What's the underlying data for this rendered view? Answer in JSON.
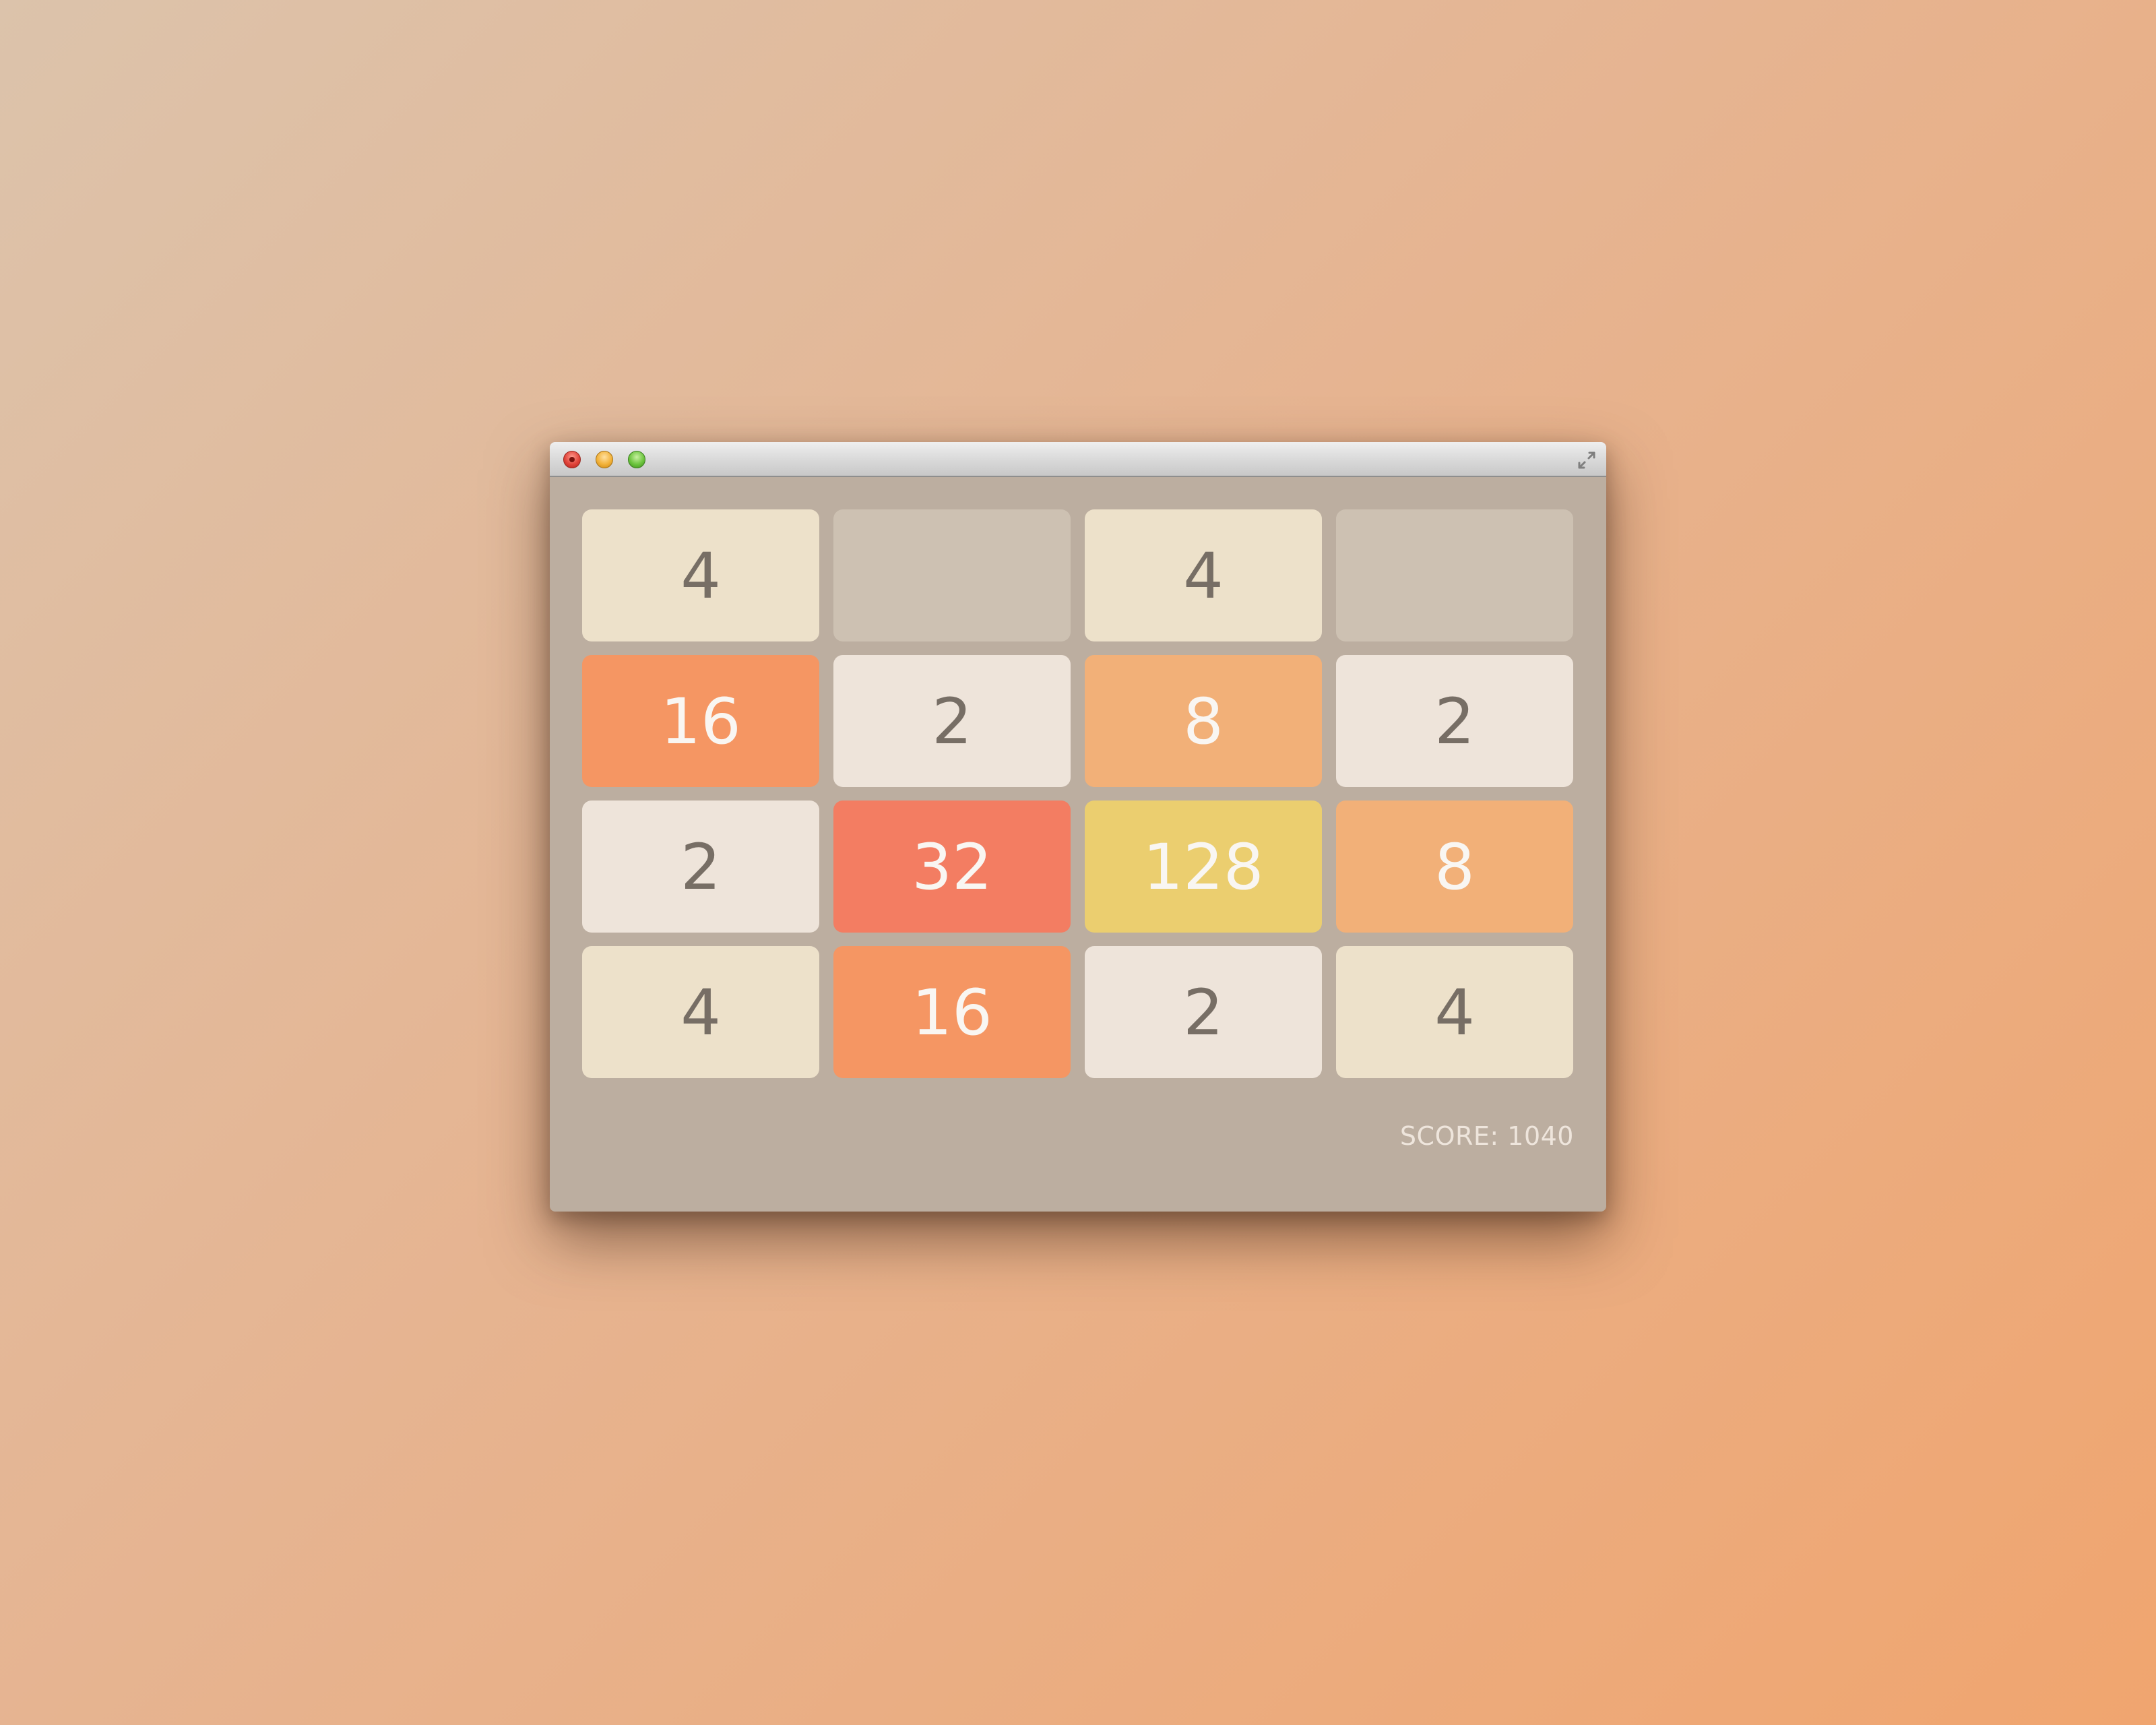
{
  "window": {
    "controls": [
      "close",
      "minimize",
      "zoom",
      "fullscreen"
    ]
  },
  "board": {
    "tiles": [
      {
        "value": "4",
        "bg": "#ede1ca",
        "fg": "#776e65"
      },
      {
        "value": "",
        "bg": "#cdc1b2",
        "fg": "#776e65"
      },
      {
        "value": "4",
        "bg": "#ede1ca",
        "fg": "#776e65"
      },
      {
        "value": "",
        "bg": "#cdc1b2",
        "fg": "#776e65"
      },
      {
        "value": "16",
        "bg": "#f59663",
        "fg": "#f9f6f2"
      },
      {
        "value": "2",
        "bg": "#eee4da",
        "fg": "#776e65"
      },
      {
        "value": "8",
        "bg": "#f2b078",
        "fg": "#f9f6f2"
      },
      {
        "value": "2",
        "bg": "#eee4da",
        "fg": "#776e65"
      },
      {
        "value": "2",
        "bg": "#eee4da",
        "fg": "#776e65"
      },
      {
        "value": "32",
        "bg": "#f37d62",
        "fg": "#f9f6f2"
      },
      {
        "value": "128",
        "bg": "#ebce6f",
        "fg": "#f9f6f2"
      },
      {
        "value": "8",
        "bg": "#f2b078",
        "fg": "#f9f6f2"
      },
      {
        "value": "4",
        "bg": "#ede1ca",
        "fg": "#776e65"
      },
      {
        "value": "16",
        "bg": "#f59663",
        "fg": "#f9f6f2"
      },
      {
        "value": "2",
        "bg": "#eee4da",
        "fg": "#776e65"
      },
      {
        "value": "4",
        "bg": "#ede1ca",
        "fg": "#776e65"
      }
    ]
  },
  "score": {
    "text": "SCORE: 1040"
  },
  "colors": {
    "window_bg": "#bcaea0",
    "empty_tile": "#cdc1b2",
    "score_text": "#eee5dc"
  }
}
